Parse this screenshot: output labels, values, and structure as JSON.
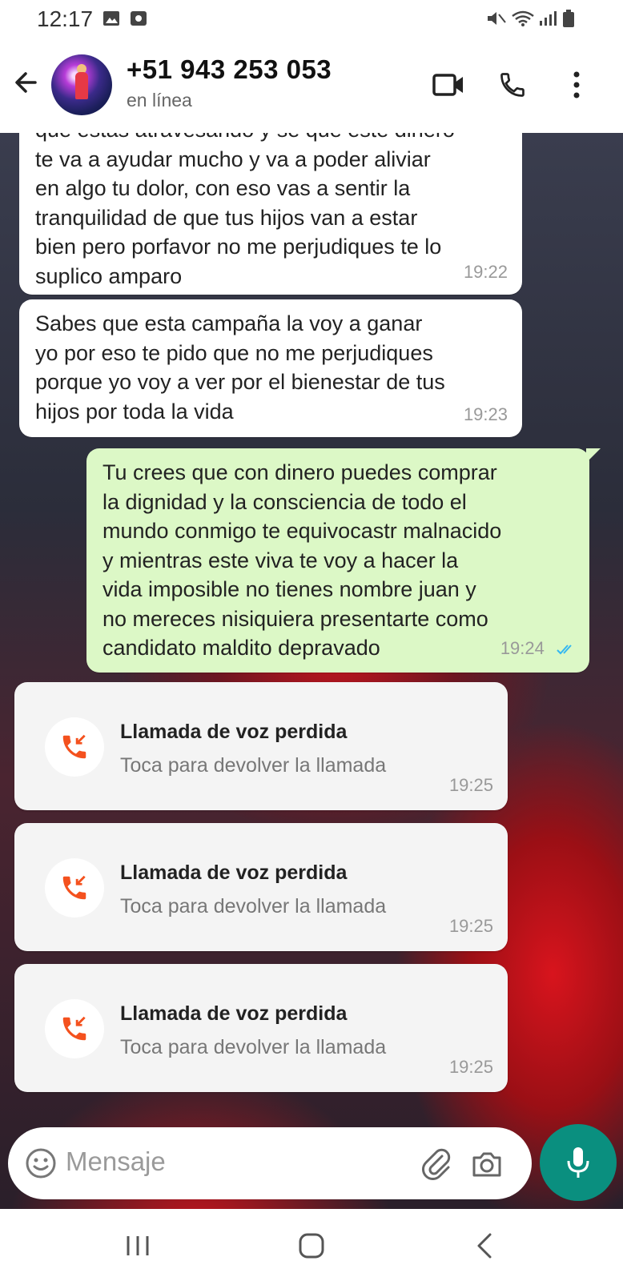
{
  "status_bar": {
    "time": "12:17",
    "left_icons": [
      "image-icon",
      "square-dot-icon"
    ],
    "right_icons": [
      "mute-icon",
      "wifi-icon",
      "signal-icon",
      "battery-icon"
    ]
  },
  "header": {
    "contact_name": "+51 943 253 053",
    "contact_status": "en línea",
    "icons": [
      "back-arrow-icon",
      "video-call-icon",
      "phone-icon",
      "more-vert-icon"
    ]
  },
  "messages": [
    {
      "direction": "incoming",
      "lines": [
        "que estas atravesando y se que este dinero",
        "te va a ayudar mucho y va a poder aliviar",
        "en algo tu dolor, con eso vas a sentir la",
        "tranquilidad de que tus hijos van a estar",
        "bien pero porfavor no me perjudiques te lo",
        "suplico amparo"
      ],
      "time": "19:22"
    },
    {
      "direction": "incoming",
      "lines": [
        "Sabes que esta campaña la voy a ganar",
        "yo por eso te pido que no me perjudiques",
        "porque yo voy a ver por el bienestar de tus",
        "hijos por toda la vida"
      ],
      "time": "19:23"
    },
    {
      "direction": "outgoing",
      "lines": [
        "Tu crees que con dinero puedes comprar",
        "la dignidad y la consciencia de todo el",
        "mundo conmigo te equivocastr malnacido",
        "y mientras este viva te voy a hacer la",
        "vida imposible no tienes nombre juan y",
        "no mereces nisiquiera presentarte como",
        "candidato maldito depravado"
      ],
      "time": "19:24",
      "status": "read"
    }
  ],
  "missed_calls": [
    {
      "title": "Llamada de voz perdida",
      "subtitle": "Toca para devolver la llamada",
      "time": "19:25"
    },
    {
      "title": "Llamada de voz perdida",
      "subtitle": "Toca para devolver la llamada",
      "time": "19:25"
    },
    {
      "title": "Llamada de voz perdida",
      "subtitle": "Toca para devolver la llamada",
      "time": "19:25"
    }
  ],
  "composer": {
    "placeholder": "Mensaje",
    "icons": [
      "emoji-icon",
      "attach-icon",
      "camera-icon",
      "mic-icon"
    ]
  },
  "nav_bar": {
    "icons": [
      "recents-icon",
      "home-icon",
      "back-icon"
    ]
  },
  "colors": {
    "outgoing_bubble": "#dcf8c6",
    "incoming_bubble": "#ffffff",
    "missed_call": "#f4511e",
    "mic_button": "#0a8f7f",
    "read_ticks": "#34b7f1"
  }
}
